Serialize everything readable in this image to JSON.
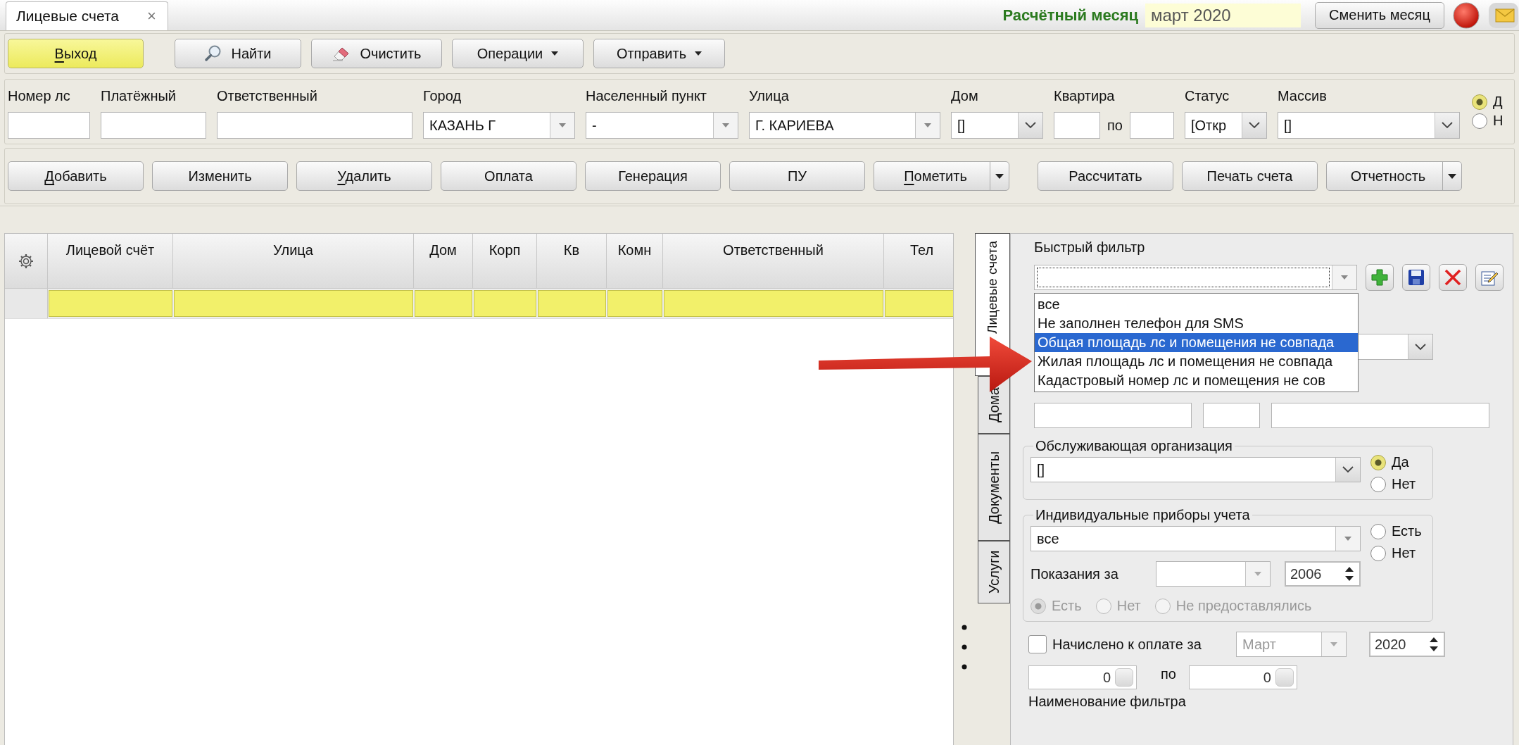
{
  "tabs": [
    {
      "label": "Лицевые счета",
      "close": "×",
      "selected": true
    }
  ],
  "period": {
    "label": "Расчётный месяц",
    "value": "март 2020",
    "button": "Сменить месяц"
  },
  "toolbar": [
    {
      "label": "Выход",
      "kind": "exit",
      "mnemonic": true
    },
    {
      "label": "Найти",
      "kind": "search",
      "mnemonic": false
    },
    {
      "label": "Очистить",
      "kind": "clear",
      "mnemonic": false
    },
    {
      "label": "Операции",
      "kind": "menu",
      "mnemonic": false
    },
    {
      "label": "Отправить",
      "kind": "menu",
      "mnemonic": false
    }
  ],
  "filters": [
    {
      "label": "Номер лс",
      "kind": "text"
    },
    {
      "label": "Платёжный",
      "kind": "text"
    },
    {
      "label": "Ответственный",
      "kind": "text"
    },
    {
      "label": "Город",
      "kind": "combo",
      "value": "КАЗАНЬ Г"
    },
    {
      "label": "Населенный пункт",
      "kind": "combo",
      "value": "-"
    },
    {
      "label": "Улица",
      "kind": "combo",
      "value": "Г. КАРИЕВА"
    },
    {
      "label": "Дом",
      "kind": "select",
      "value": "[]"
    },
    {
      "label": "Квартира",
      "kind": "range",
      "between": "по"
    },
    {
      "label": "Статус",
      "kind": "select",
      "value": "[Откр"
    },
    {
      "label": "Массив",
      "kind": "select",
      "value": "[]"
    }
  ],
  "scope": [
    {
      "label": "Д",
      "selected": true
    },
    {
      "label": "Н",
      "selected": false
    }
  ],
  "actions": [
    {
      "label": "Добавить",
      "mnemonic": true,
      "split": false
    },
    {
      "label": "Изменить",
      "mnemonic": false,
      "split": false
    },
    {
      "label": "Удалить",
      "mnemonic": true,
      "split": false
    },
    {
      "label": "Оплата",
      "mnemonic": false,
      "split": false
    },
    {
      "label": "Генерация",
      "mnemonic": false,
      "split": false
    },
    {
      "label": "ПУ",
      "mnemonic": false,
      "split": false
    },
    {
      "label": "Пометить",
      "mnemonic": true,
      "split": true
    },
    {
      "label": "Рассчитать",
      "mnemonic": false,
      "split": false
    },
    {
      "label": "Печать счета",
      "mnemonic": false,
      "split": false
    },
    {
      "label": "Отчетность",
      "mnemonic": false,
      "split": true
    }
  ],
  "table": {
    "columns": [
      "Лицевой счёт",
      "Улица",
      "Дом",
      "Корп",
      "Кв",
      "Комн",
      "Ответственный",
      "Тел"
    ]
  },
  "side_tabs": [
    {
      "label": "Лицевые счета",
      "selected": true
    },
    {
      "label": "Дома",
      "selected": false
    },
    {
      "label": "Документы",
      "selected": false
    },
    {
      "label": "Услуги",
      "selected": false
    }
  ],
  "quick_filter": {
    "label": "Быстрый фильтр",
    "options": [
      {
        "label": "все",
        "selected": false
      },
      {
        "label": "Не заполнен телефон для SMS",
        "selected": false
      },
      {
        "label": "Общая площадь лс и помещения не совпада",
        "selected": true
      },
      {
        "label": "Жилая площадь лс и помещения не совпада",
        "selected": false
      },
      {
        "label": "Кадастровый номер лс и помещения не сов",
        "selected": false
      }
    ]
  },
  "service_org": {
    "legend": "Обслуживающая организация",
    "value": "[]",
    "radios": [
      {
        "label": "Да",
        "selected": true
      },
      {
        "label": "Нет",
        "selected": false
      }
    ]
  },
  "meters": {
    "legend": "Индивидуальные приборы учета",
    "value": "все",
    "radios": [
      {
        "label": "Есть",
        "selected": false
      },
      {
        "label": "Нет",
        "selected": false
      }
    ],
    "readings_label": "Показания за",
    "year": "2006",
    "reading_radios": [
      {
        "label": "Есть",
        "selected": true,
        "disabled": true
      },
      {
        "label": "Нет",
        "selected": false,
        "disabled": true
      },
      {
        "label": "Не предоставлялись",
        "selected": false,
        "disabled": true
      }
    ]
  },
  "charged": {
    "label": "Начислено к оплате за",
    "checked": false,
    "month": {
      "value": "Март",
      "disabled": true
    },
    "year": "2020",
    "from": "0",
    "between": "по",
    "to": "0"
  },
  "filter_name": {
    "label": "Наименование фильтра"
  }
}
